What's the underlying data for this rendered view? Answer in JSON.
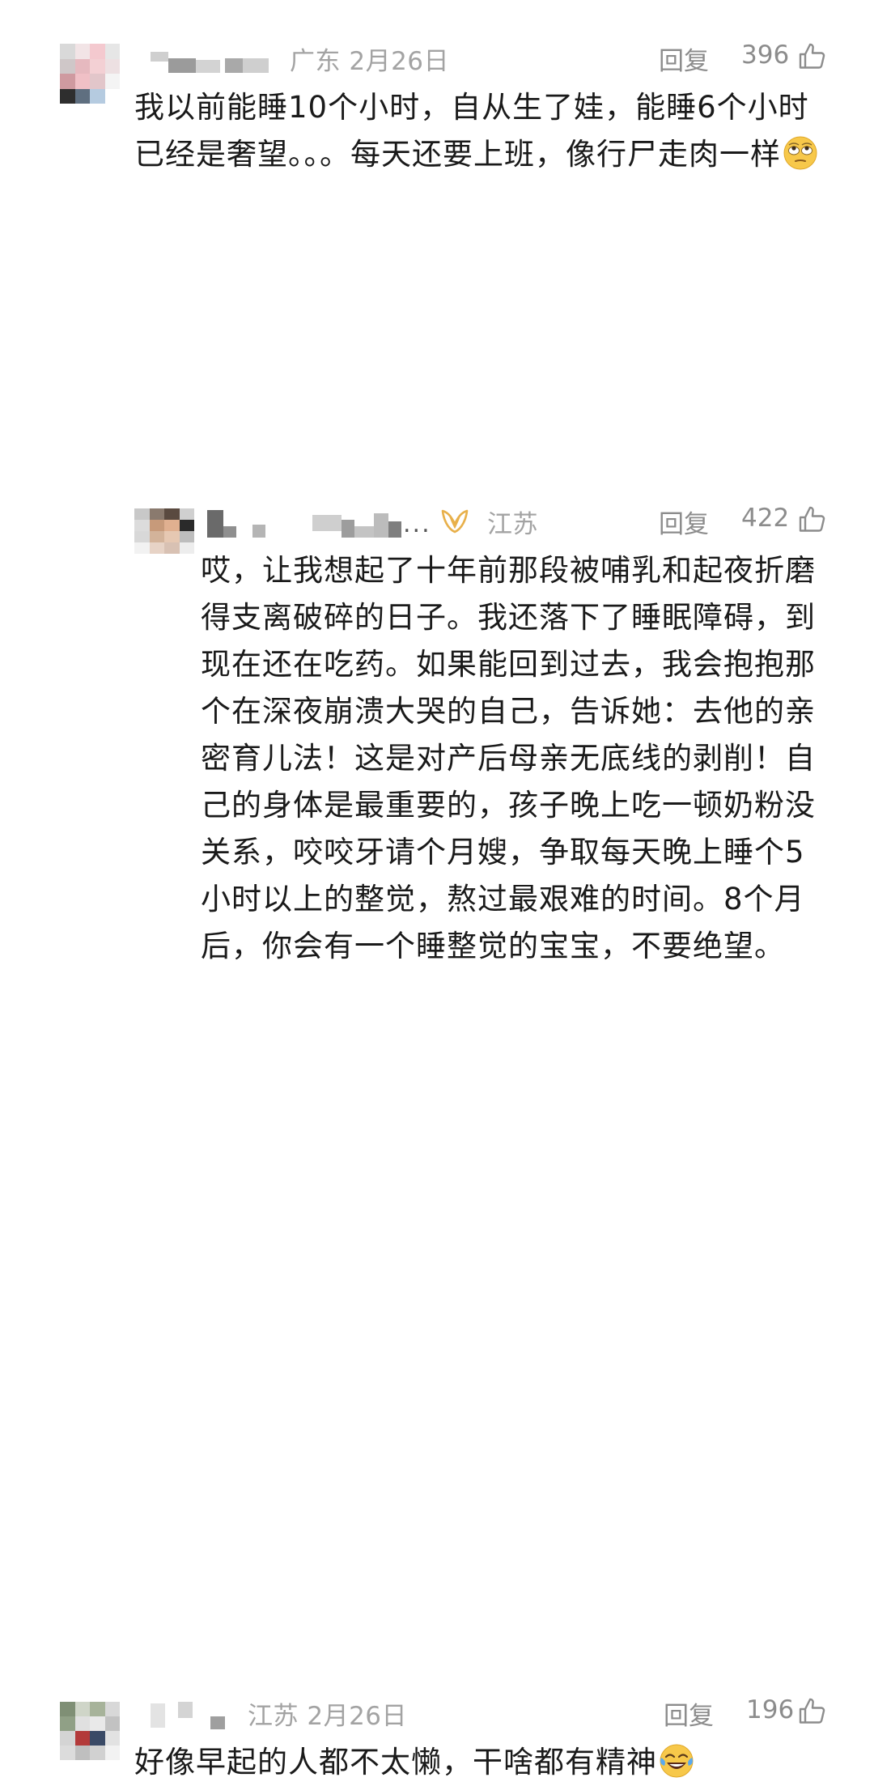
{
  "comments": [
    {
      "location_date": "广东 2月26日",
      "reply_label": "回复",
      "likes": "396",
      "text": "我以前能睡10个小时，自从生了娃，能睡6个小时已经是奢望。。。每天还要上班，像行尸走肉一样",
      "emoji": "rolling-eyes-emoji"
    },
    {
      "location": "江苏",
      "ellipsis": "...",
      "reply_label": "回复",
      "likes": "422",
      "text": "哎，让我想起了十年前那段被哺乳和起夜折磨得支离破碎的日子。我还落下了睡眠障碍，到现在还在吃药。如果能回到过去，我会抱抱那个在深夜崩溃大哭的自己，告诉她：去他的亲密育儿法！这是对产后母亲无底线的剥削！自己的身体是最重要的，孩子晚上吃一顿奶粉没关系，咬咬牙请个月嫂，争取每天晚上睡个5小时以上的整觉，熬过最艰难的时间。8个月后，你会有一个睡整觉的宝宝，不要绝望。",
      "badge_icon": "member-badge-icon"
    },
    {
      "location_date": "江苏 2月26日",
      "reply_label": "回复",
      "likes": "196",
      "text": "好像早起的人都不太懒，干啥都有精神",
      "emoji": "tears-of-joy-emoji"
    }
  ],
  "colors": {
    "meta_text": "#a3a3a3",
    "action_text": "#8c8c8c",
    "body_text": "#1a1a1a",
    "badge": "#e8b04a"
  }
}
